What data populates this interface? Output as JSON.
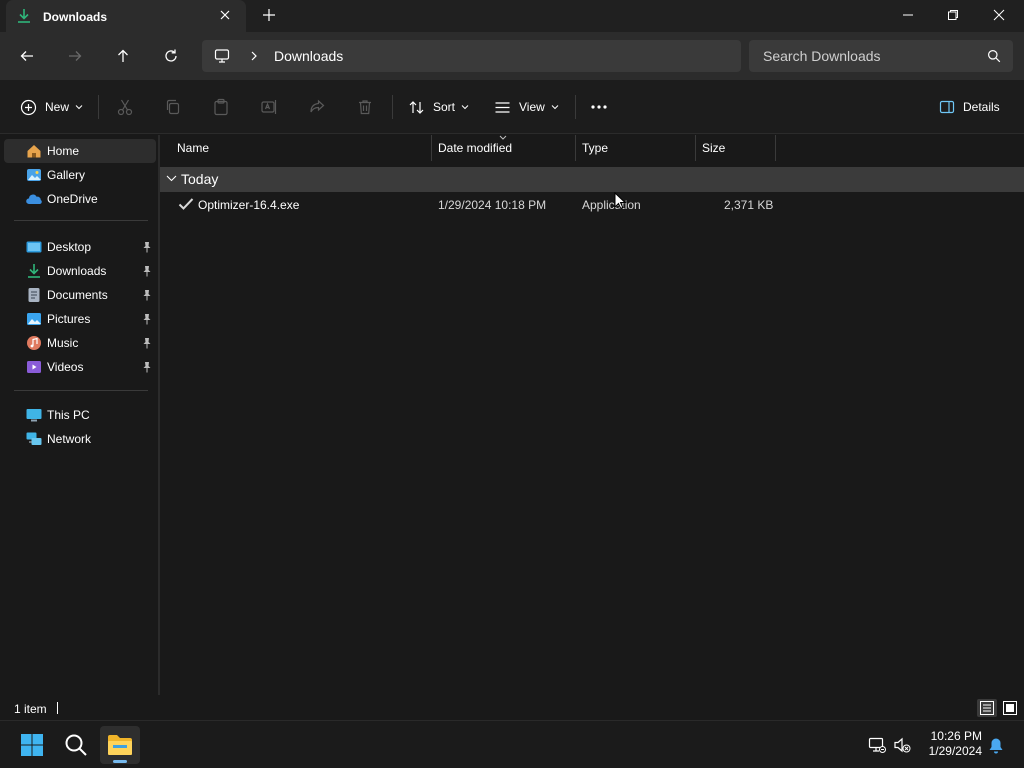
{
  "window": {
    "tab_title": "Downloads",
    "tab_icon": "download-icon",
    "controls": [
      "minimize-icon",
      "restore-icon",
      "close-icon"
    ]
  },
  "address_bar": {
    "breadcrumb": [
      "Downloads"
    ],
    "location_icon": "this-pc-icon",
    "search_placeholder": "Search Downloads"
  },
  "command_bar": {
    "new_label": "New",
    "sort_label": "Sort",
    "view_label": "View",
    "details_label": "Details",
    "disabled_icons": [
      "cut-icon",
      "copy-icon",
      "paste-icon",
      "rename-icon",
      "share-icon",
      "delete-icon"
    ]
  },
  "sidebar": {
    "quick": [
      {
        "label": "Home",
        "icon": "home-icon",
        "color": "#e8a44c"
      },
      {
        "label": "Gallery",
        "icon": "gallery-icon",
        "color": "#4aa3e8"
      },
      {
        "label": "OneDrive",
        "icon": "onedrive-icon",
        "color": "#3b8fe0"
      }
    ],
    "pinned": [
      {
        "label": "Desktop",
        "icon": "desktop-icon",
        "color": "#2e9de0"
      },
      {
        "label": "Downloads",
        "icon": "download-icon",
        "color": "#2fb57a"
      },
      {
        "label": "Documents",
        "icon": "documents-icon",
        "color": "#a8b3c2"
      },
      {
        "label": "Pictures",
        "icon": "pictures-icon",
        "color": "#3aa5f0"
      },
      {
        "label": "Music",
        "icon": "music-icon",
        "color": "#e07a5f"
      },
      {
        "label": "Videos",
        "icon": "videos-icon",
        "color": "#8a5cd8"
      }
    ],
    "devices": [
      {
        "label": "This PC",
        "icon": "this-pc-icon",
        "color": "#3fb4e6"
      },
      {
        "label": "Network",
        "icon": "network-icon",
        "color": "#3fb4e6"
      }
    ]
  },
  "file_list": {
    "columns": [
      "Name",
      "Date modified",
      "Type",
      "Size"
    ],
    "group_label": "Today",
    "rows": [
      {
        "name": "Optimizer-16.4.exe",
        "date": "1/29/2024 10:18 PM",
        "type": "Application",
        "size": "2,371 KB"
      }
    ]
  },
  "status_bar": {
    "item_count": "1 item"
  },
  "taskbar": {
    "apps": [
      "start-icon",
      "search-icon",
      "file-explorer-icon"
    ],
    "time": "10:26 PM",
    "date": "1/29/2024",
    "tray_icons": [
      "network-status-icon",
      "volume-muted-icon",
      "notification-bell-icon"
    ]
  }
}
